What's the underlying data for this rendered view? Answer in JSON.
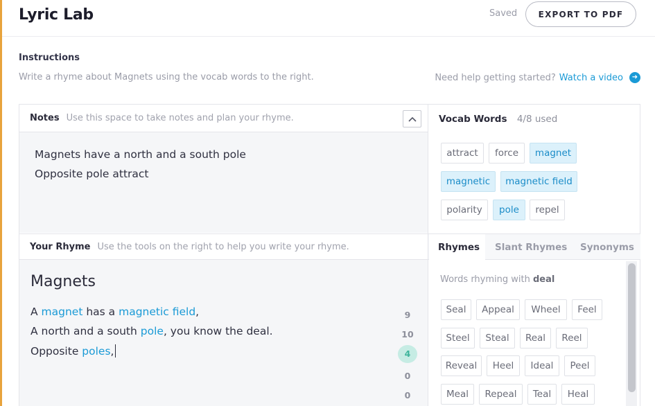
{
  "app": {
    "title": "Lyric Lab",
    "saved": "Saved",
    "export_label": "EXPORT TO PDF"
  },
  "instructions": {
    "title": "Instructions",
    "text": "Write a rhyme about Magnets using the vocab words to the right.",
    "help_prefix": "Need help getting started?",
    "help_link": "Watch a video"
  },
  "notes": {
    "title": "Notes",
    "hint": "Use this space to take notes and plan your rhyme.",
    "lines": [
      "Magnets have a north and a south pole",
      "Opposite pole attract"
    ]
  },
  "rhyme": {
    "title": "Your Rhyme",
    "hint": "Use the tools on the right to help you write your rhyme.",
    "heading": "Magnets",
    "line1": {
      "a": "A ",
      "b": "magnet",
      "c": " has a ",
      "d": "magnetic field",
      "e": ","
    },
    "line2": {
      "a": "A north and a south ",
      "b": "pole",
      "c": ", you know the deal."
    },
    "line3": {
      "a": "Opposite ",
      "b": "poles",
      "c": ","
    },
    "syllables": [
      "9",
      "10",
      "4",
      "0",
      "0"
    ]
  },
  "vocab": {
    "title": "Vocab Words",
    "used": "4/8 used",
    "words": [
      "attract",
      "force",
      "magnet",
      "magnetic",
      "magnetic field",
      "polarity",
      "pole",
      "repel"
    ]
  },
  "tabs": [
    "Rhymes",
    "Slant Rhymes",
    "Synonyms"
  ],
  "rhymes": {
    "hint_prefix": "Words rhyming with",
    "word": "deal",
    "results": [
      "Seal",
      "Appeal",
      "Wheel",
      "Feel",
      "Steel",
      "Steal",
      "Real",
      "Reel",
      "Reveal",
      "Heel",
      "Ideal",
      "Peel",
      "Meal",
      "Repeal",
      "Teal",
      "Heal"
    ]
  },
  "colors": {
    "accent": "#1a9ad6",
    "vocab_used_bg": "#dcf1fb",
    "syllable_active": "#3fb59c"
  }
}
